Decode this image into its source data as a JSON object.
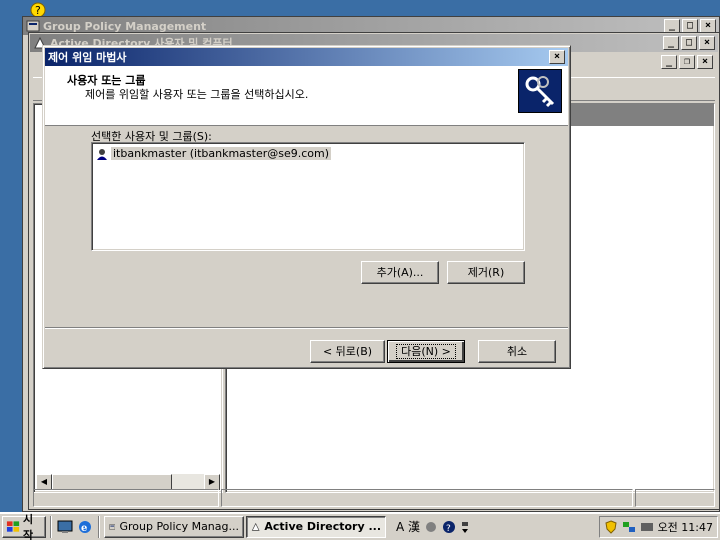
{
  "background_window": {
    "title": "Group Policy Management"
  },
  "ad_window": {
    "title": "Active Directory 사용자 및 컴퓨터"
  },
  "wizard": {
    "title": "제어 위임 마법사",
    "header_title": "사용자 또는 그룹",
    "header_subtitle": "제어를 위임할 사용자 또는 그룹을 선택하십시오.",
    "list_label": "선택한 사용자 및 그룹(S):",
    "list_items": [
      {
        "label": "itbankmaster (itbankmaster@se9.com)",
        "icon": "user-icon"
      }
    ],
    "add_button": "추가(A)...",
    "remove_button": "제거(R)",
    "back_button": "< 뒤로(B)",
    "next_button": "다음(N) >",
    "cancel_button": "취소",
    "close_glyph": "×"
  },
  "taskbar": {
    "start_label": "시작",
    "tasks": [
      {
        "label": "Group Policy Manag...",
        "icon": "gpm-icon",
        "active": false
      },
      {
        "label": "Active Directory ...",
        "icon": "ad-icon",
        "active": true
      }
    ],
    "ime_text": "A 漢",
    "clock": "오전 11:47"
  },
  "colors": {
    "desktop": "#3a6ea5",
    "title_active": "#0a246a",
    "face": "#d4d0c8"
  }
}
